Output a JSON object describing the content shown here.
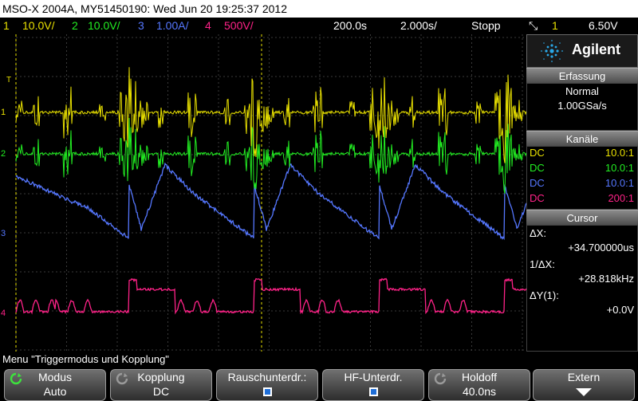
{
  "title": "MSO-X 2004A, MY51450190: Wed Jun 20 19:25:37 2012",
  "status": {
    "ch1_num": "1",
    "ch1_scale": "10.0V/",
    "ch2_num": "2",
    "ch2_scale": "10.0V/",
    "ch3_num": "3",
    "ch3_scale": "1.00A/",
    "ch4_num": "4",
    "ch4_scale": "500V/",
    "delay": "200.0s",
    "timebase": "2.000s/",
    "run_state": "Stopp",
    "trigger_icon": "trigger-edge-icon",
    "trig_src": "1",
    "trig_level": "6.50V"
  },
  "colors": {
    "ch1": "#e8e000",
    "ch2": "#22ee22",
    "ch3": "#5577ff",
    "ch4": "#ff2288",
    "grid": "#3a3a3a",
    "run_state": "#e06000"
  },
  "brand": "Agilent",
  "acquisition": {
    "header": "Erfassung",
    "mode": "Normal",
    "rate": "1.00GSa/s"
  },
  "channels": {
    "header": "Kanäle",
    "rows": [
      {
        "coupling": "DC",
        "probe": "10.0:1"
      },
      {
        "coupling": "DC",
        "probe": "10.0:1"
      },
      {
        "coupling": "DC",
        "probe": "10.0:1"
      },
      {
        "coupling": "DC",
        "probe": "200:1"
      }
    ]
  },
  "cursor": {
    "header": "Cursor",
    "dx_label": "ΔX:",
    "dx_value": "+34.700000us",
    "inv_dx_label": "1/ΔX:",
    "inv_dx_value": "+28.818kHz",
    "dy_label": "ΔY(1):",
    "dy_value": "+0.0V"
  },
  "plot": {
    "ch1_marker": "1",
    "ch2_marker": "2",
    "ch3_marker": "3",
    "ch4_marker": "4",
    "trigger_marker": "T"
  },
  "menu": {
    "label": "Menu \"Triggermodus und Kopplung\""
  },
  "softkeys": [
    {
      "name": "Modus",
      "value": "Auto",
      "icon": "rotate-knob-icon"
    },
    {
      "name": "Kopplung",
      "value": "DC",
      "icon": "rotate-knob-icon"
    },
    {
      "name": "Rauschunterdr.:",
      "value": "",
      "icon": "checkbox-icon"
    },
    {
      "name": "HF-Unterdr.",
      "value": "",
      "icon": "checkbox-icon"
    },
    {
      "name": "Holdoff",
      "value": "40.0ns",
      "icon": "rotate-knob-icon"
    },
    {
      "name": "Extern",
      "value": "",
      "icon": "arrow-down-icon"
    }
  ]
}
